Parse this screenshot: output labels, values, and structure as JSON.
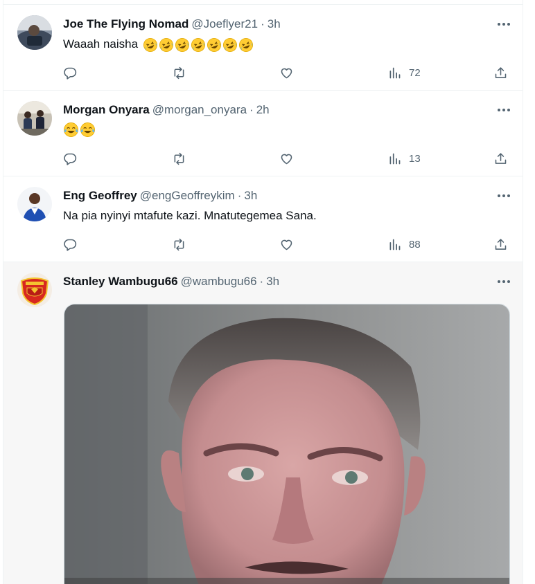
{
  "tweets": [
    {
      "display_name": "Joe The Flying Nomad",
      "handle": "@Joeflyer21",
      "time": "3h",
      "text": "Waaah naisha",
      "emoji": [
        "rofl",
        "rofl",
        "rofl",
        "rofl",
        "rofl",
        "rofl",
        "rofl"
      ],
      "views": "72",
      "avatar_icon": "avatar-photo-icon"
    },
    {
      "display_name": "Morgan Onyara",
      "handle": "@morgan_onyara",
      "time": "2h",
      "text": "",
      "emoji": [
        "joy",
        "joy"
      ],
      "views": "13",
      "avatar_icon": "avatar-photo-icon"
    },
    {
      "display_name": "Eng Geoffrey",
      "handle": "@engGeoffreykim",
      "time": "3h",
      "text": "Na pia nyinyi mtafute kazi. Mnatutegemea Sana.",
      "emoji": [],
      "views": "88",
      "avatar_icon": "avatar-photo-icon"
    },
    {
      "display_name": "Stanley Wambugu66",
      "handle": "@wambugu66",
      "time": "3h",
      "text": "",
      "emoji": [],
      "media": "photo of a grey-haired man with a stern expression",
      "avatar_icon": "manchester-united-crest-icon"
    }
  ],
  "separator": "·",
  "icons": {
    "reply": "reply-icon",
    "retweet": "retweet-icon",
    "like": "heart-icon",
    "views": "views-chart-icon",
    "share": "share-icon",
    "more": "more-options-icon"
  },
  "colors": {
    "text_primary": "#0f1419",
    "text_secondary": "#536471",
    "border": "#eff3f4",
    "highlight_bg": "#f7f7f7"
  }
}
